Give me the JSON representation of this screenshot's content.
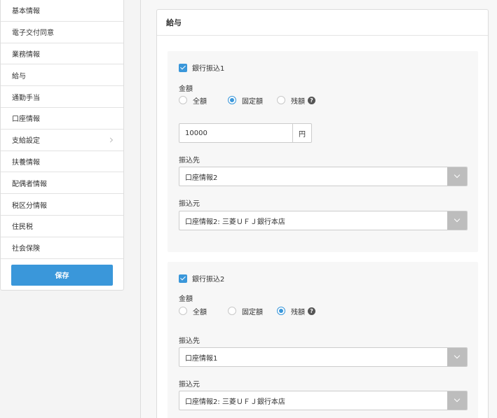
{
  "sidebar": {
    "items": [
      {
        "label": "基本情報"
      },
      {
        "label": "電子交付同意"
      },
      {
        "label": "業務情報"
      },
      {
        "label": "給与"
      },
      {
        "label": "通勤手当"
      },
      {
        "label": "口座情報"
      },
      {
        "label": "支給設定",
        "has_submenu": true
      },
      {
        "label": "扶養情報"
      },
      {
        "label": "配偶者情報"
      },
      {
        "label": "税区分情報"
      },
      {
        "label": "住民税"
      },
      {
        "label": "社会保険"
      }
    ],
    "save_label": "保存"
  },
  "panel": {
    "title": "給与",
    "transfers": [
      {
        "checkbox_label": "銀行振込1",
        "checked": true,
        "amount_label": "金額",
        "options": [
          "全額",
          "固定額",
          "残額"
        ],
        "selected": "固定額",
        "amount_value": "10000",
        "amount_unit": "円",
        "dest_label": "振込先",
        "dest_value": "口座情報2",
        "source_label": "振込元",
        "source_value": "口座情報2: 三菱ＵＦＪ銀行本店"
      },
      {
        "checkbox_label": "銀行振込2",
        "checked": true,
        "amount_label": "金額",
        "options": [
          "全額",
          "固定額",
          "残額"
        ],
        "selected": "残額",
        "dest_label": "振込先",
        "dest_value": "口座情報1",
        "source_label": "振込元",
        "source_value": "口座情報2: 三菱ＵＦＪ銀行本店"
      }
    ],
    "help_glyph": "?"
  },
  "colors": {
    "accent": "#3a97da",
    "select_arrow_bg": "#bdbdbd"
  }
}
